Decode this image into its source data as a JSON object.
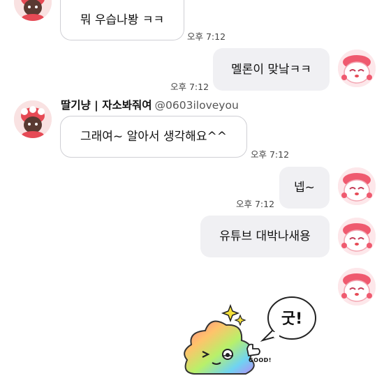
{
  "sender_name": "딸기냥 | 자소봐줘여",
  "sender_handle": "@0603iloveyou",
  "messages": [
    {
      "dir": "in",
      "text": "뭐 우습나봥 ㅋㅋ",
      "time": "오후 7:12"
    },
    {
      "dir": "out",
      "text": "멜론이 맞낰ㅋㅋ",
      "time": "오후 7:12"
    },
    {
      "dir": "in",
      "text": "그래여~ 알아서 생각해요^^",
      "time": "오후 7:12"
    },
    {
      "dir": "out",
      "text": "넵~",
      "time": "오후 7:12"
    },
    {
      "dir": "out",
      "text": "유튜브 대박나새용",
      "time": ""
    }
  ],
  "sticker": {
    "speech_text": "굿!",
    "caption": "GOOD!",
    "icon": "rainbow-poop-sticker-icon"
  },
  "colors": {
    "incoming_bubble_bg": "#ffffff",
    "incoming_bubble_border": "#cfcfd4",
    "outgoing_bubble_bg": "#f0f0f3",
    "timestamp": "#444444"
  }
}
